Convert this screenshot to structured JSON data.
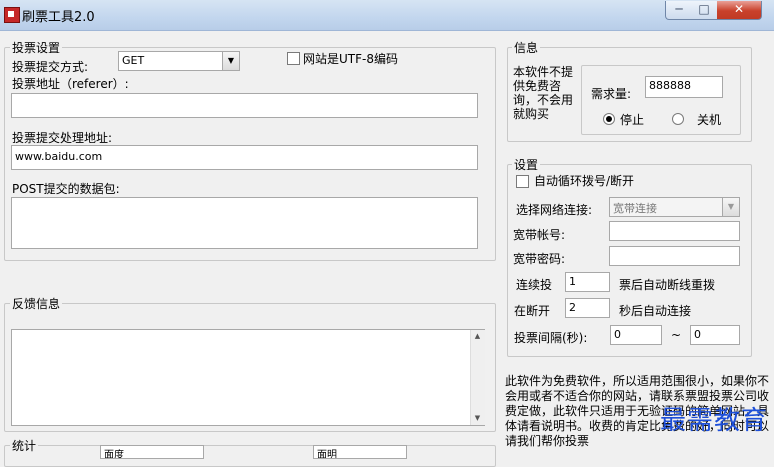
{
  "window": {
    "title": "刷票工具2.0",
    "min": "─",
    "max": "□",
    "close": "✕"
  },
  "vote": {
    "legend": "投票设置",
    "method_label": "投票提交方式:",
    "method_value": "GET",
    "utf8_label": "网站是UTF-8编码",
    "referer_label": "投票地址（referer）:",
    "referer_value": "",
    "handler_label": "投票提交处理地址:",
    "handler_value": "www.baidu.com",
    "post_label": "POST提交的数据包:",
    "post_value": ""
  },
  "info": {
    "legend": "信息",
    "text": "本软件不提供免费咨询，不会用就购买",
    "demand_label": "需求量:",
    "demand_value": "888888",
    "stop_label": "停止",
    "close_label": "关机"
  },
  "settings": {
    "legend": "设置",
    "auto_dial_label": "自动循环拨号/断开",
    "network_label": "选择网络连接:",
    "network_value": "宽带连接",
    "account_label": "宽带帐号:",
    "account_value": "",
    "password_label": "宽带密码:",
    "password_value": "",
    "consecutive_prefix": "连续投",
    "consecutive_value": "1",
    "consecutive_suffix": "票后自动断线重拨",
    "reconnect_prefix": "在断开",
    "reconnect_value": "2",
    "reconnect_suffix": "秒后自动连接",
    "interval_label": "投票间隔(秒):",
    "interval_from": "0",
    "interval_sep": "~",
    "interval_to": "0"
  },
  "feedback": {
    "legend": "反馈信息",
    "value": ""
  },
  "stats": {
    "legend": "统计",
    "field1": "面度",
    "field2": "面明"
  },
  "notice": "此软件为免费软件，所以适用范围很小，如果你不会用或者不适合你的网站，请联系票盟投票公司收费定做，此软件只适用于无验证码的简单网站，具体请看说明书。收费的肯定比免费的好，同时可以请我们帮你投票",
  "watermark": "最需教育"
}
